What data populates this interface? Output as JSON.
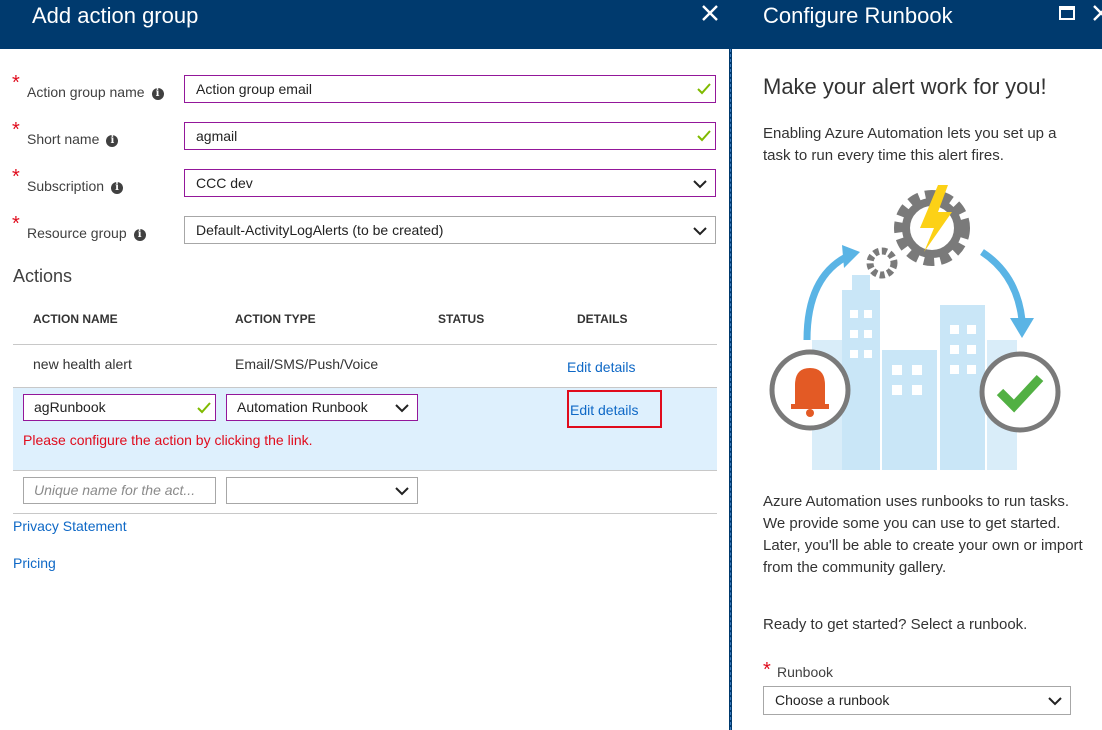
{
  "left": {
    "title": "Add action group",
    "fields": [
      {
        "label": "Action group name",
        "value": "Action group email"
      },
      {
        "label": "Short name",
        "value": "agmail"
      },
      {
        "label": "Subscription",
        "value": "CCC dev"
      },
      {
        "label": "Resource group",
        "value": "Default-ActivityLogAlerts (to be created)"
      }
    ],
    "info_glyph": "i",
    "required_mark": "*",
    "actions_title": "Actions",
    "columns": [
      "ACTION NAME",
      "ACTION TYPE",
      "STATUS",
      "DETAILS"
    ],
    "rows": [
      {
        "name": "new health alert",
        "type": "Email/SMS/Push/Voice",
        "status": "",
        "details": "Edit details"
      },
      {
        "name": "agRunbook",
        "type": "Automation Runbook",
        "status": "",
        "details": "Edit details",
        "error": "Please configure the action by clicking the link."
      }
    ],
    "new_row": {
      "name_placeholder": "Unique name for the act...",
      "type": ""
    },
    "privacy": "Privacy Statement",
    "pricing": "Pricing"
  },
  "right": {
    "title": "Configure Runbook",
    "heading": "Make your alert work for you!",
    "intro": "Enabling Azure Automation lets you set up a task to run every time this alert fires.",
    "body": "Azure Automation uses runbooks to run tasks. We provide some you can use to get started. Later, you'll be able to create your own or import from the community gallery.",
    "ready": "Ready to get started? Select a runbook.",
    "runbook_label": "Runbook",
    "runbook_value": "Choose a runbook"
  },
  "colors": {
    "header_bg": "#003a6e",
    "link": "#0e68c6",
    "error": "#e00b1c",
    "valid_border": "#93179a",
    "selected_row": "#def0fd",
    "check": "#7fba00"
  },
  "icons": [
    "close-icon",
    "info-icon",
    "check-icon",
    "chevron-down-icon",
    "maximize-icon"
  ]
}
